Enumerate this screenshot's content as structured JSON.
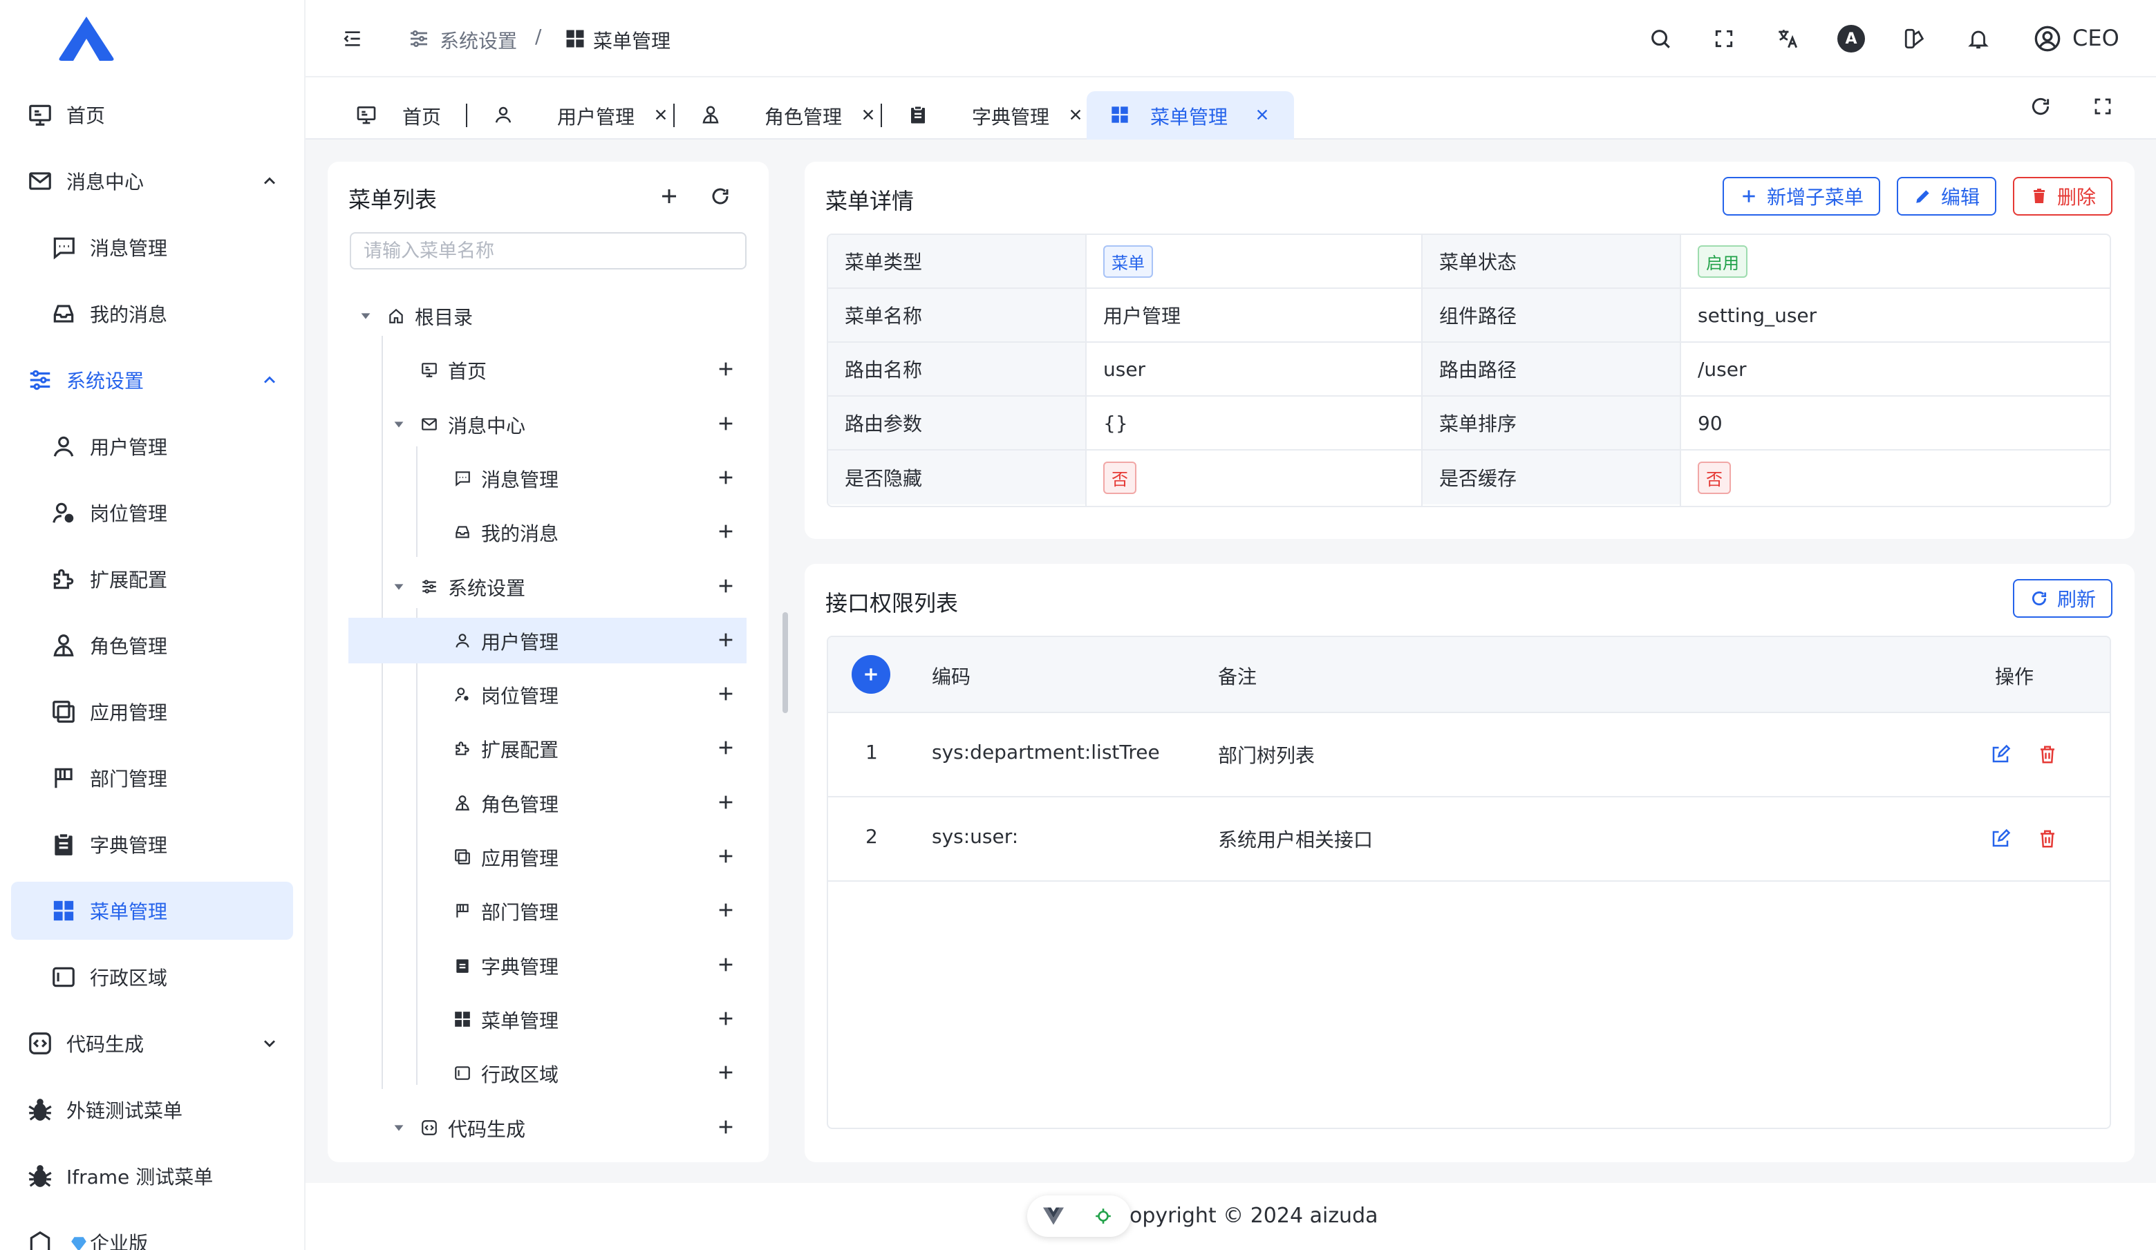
{
  "sidebar": {
    "items": [
      {
        "label": "首页",
        "icon": "monitor-icon"
      },
      {
        "label": "消息中心",
        "icon": "mail-icon"
      },
      {
        "label": "消息管理",
        "icon": "message-icon"
      },
      {
        "label": "我的消息",
        "icon": "inbox-icon"
      },
      {
        "label": "系统设置",
        "icon": "settings-sliders-icon"
      },
      {
        "label": "用户管理",
        "icon": "user-icon"
      },
      {
        "label": "岗位管理",
        "icon": "user-badge-icon"
      },
      {
        "label": "扩展配置",
        "icon": "puzzle-icon"
      },
      {
        "label": "角色管理",
        "icon": "role-icon"
      },
      {
        "label": "应用管理",
        "icon": "apps-icon"
      },
      {
        "label": "部门管理",
        "icon": "flag-icon"
      },
      {
        "label": "字典管理",
        "icon": "clipboard-icon"
      },
      {
        "label": "菜单管理",
        "icon": "grid-icon"
      },
      {
        "label": "行政区域",
        "icon": "region-icon"
      },
      {
        "label": "代码生成",
        "icon": "code-icon"
      },
      {
        "label": "外链测试菜单",
        "icon": "bug-icon"
      },
      {
        "label": "Iframe 测试菜单",
        "icon": "bug-icon"
      },
      {
        "label": "企业版",
        "icon": "diamond-icon"
      }
    ]
  },
  "header": {
    "breadcrumb": [
      "系统设置",
      "/",
      "菜单管理"
    ],
    "user": "CEO",
    "theme_letter": "A"
  },
  "tabs": [
    {
      "label": "首页"
    },
    {
      "label": "用户管理"
    },
    {
      "label": "角色管理"
    },
    {
      "label": "字典管理"
    },
    {
      "label": "菜单管理"
    }
  ],
  "tree": {
    "title": "菜单列表",
    "search_placeholder": "请输入菜单名称",
    "nodes": [
      {
        "label": "根目录"
      },
      {
        "label": "首页"
      },
      {
        "label": "消息中心"
      },
      {
        "label": "消息管理"
      },
      {
        "label": "我的消息"
      },
      {
        "label": "系统设置"
      },
      {
        "label": "用户管理"
      },
      {
        "label": "岗位管理"
      },
      {
        "label": "扩展配置"
      },
      {
        "label": "角色管理"
      },
      {
        "label": "应用管理"
      },
      {
        "label": "部门管理"
      },
      {
        "label": "字典管理"
      },
      {
        "label": "菜单管理"
      },
      {
        "label": "行政区域"
      },
      {
        "label": "代码生成"
      }
    ]
  },
  "detail": {
    "title": "菜单详情",
    "btn_add": "新增子菜单",
    "btn_edit": "编辑",
    "btn_delete": "删除",
    "rows": [
      {
        "k1": "菜单类型",
        "v1": "菜单",
        "k2": "菜单状态",
        "v2": "启用"
      },
      {
        "k1": "菜单名称",
        "v1": "用户管理",
        "k2": "组件路径",
        "v2": "setting_user"
      },
      {
        "k1": "路由名称",
        "v1": "user",
        "k2": "路由路径",
        "v2": "/user"
      },
      {
        "k1": "路由参数",
        "v1": "{}",
        "k2": "菜单排序",
        "v2": "90"
      },
      {
        "k1": "是否隐藏",
        "v1": "否",
        "k2": "是否缓存",
        "v2": "否"
      }
    ]
  },
  "api": {
    "title": "接口权限列表",
    "btn_refresh": "刷新",
    "columns": [
      "编码",
      "备注",
      "操作"
    ],
    "rows": [
      {
        "index": "1",
        "code": "sys:department:listTree",
        "remark": "部门树列表"
      },
      {
        "index": "2",
        "code": "sys:user:",
        "remark": "系统用户相关接口"
      }
    ]
  },
  "footer": {
    "copyright": "opyright © 2024 aizuda"
  },
  "colors": {
    "accent": "#2563eb",
    "danger": "#e53935",
    "success": "#22a24a"
  }
}
